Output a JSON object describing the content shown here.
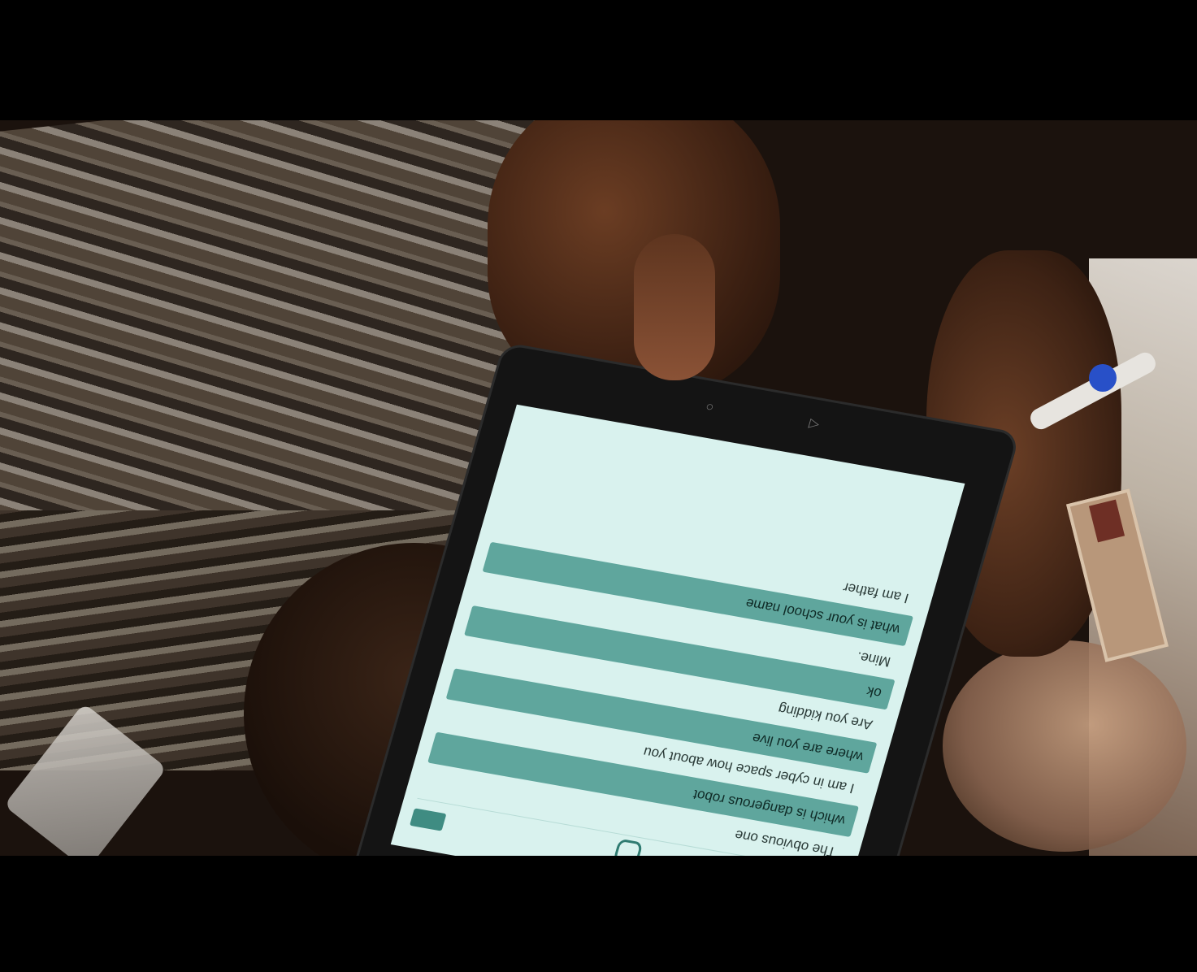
{
  "scene": {
    "description_colors": {
      "screen_background": "#d9f2ee",
      "user_bubble": "#5fa69d",
      "accent": "#1f6b60"
    }
  },
  "app": {
    "header": {
      "settings_icon": "gear-icon",
      "robot_icon": "robot-icon"
    },
    "nav": {
      "back_icon": "◁",
      "home_icon": "○"
    },
    "messages": [
      {
        "role": "bot",
        "text": "The obvious one"
      },
      {
        "role": "user",
        "text": "which is dangerous robot"
      },
      {
        "role": "bot",
        "text": "I am in cyber space how about you"
      },
      {
        "role": "user",
        "text": "where are you live"
      },
      {
        "role": "bot",
        "text": "Are you kidding"
      },
      {
        "role": "user",
        "text": "ok"
      },
      {
        "role": "bot",
        "text": "Mine."
      },
      {
        "role": "user",
        "text": "what is your school name"
      },
      {
        "role": "bot",
        "text": "I am father"
      }
    ]
  }
}
